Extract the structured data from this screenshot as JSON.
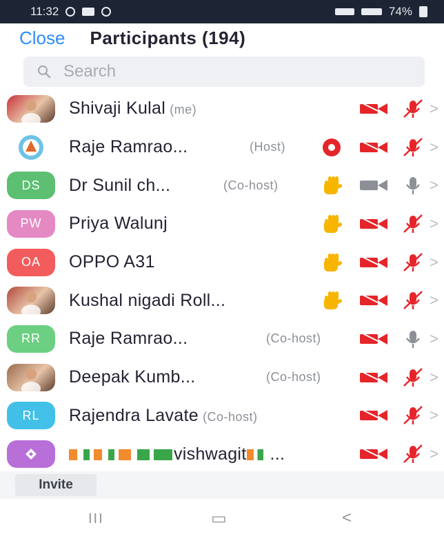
{
  "status_bar": {
    "time": "11:32",
    "battery": "74%"
  },
  "header": {
    "close_label": "Close",
    "title": "Participants (194)"
  },
  "search": {
    "placeholder": "Search"
  },
  "colors": {
    "accent": "#2d8cff",
    "muted_red": "#e5252a",
    "raise_hand": "#f7b500",
    "chevron": "#b9bcc1"
  },
  "participants": [
    {
      "name": "Shivaji Kulal",
      "role": "(me)",
      "avatar": {
        "type": "photo",
        "color": "#c7333a"
      },
      "hand_raised": false,
      "recording": false,
      "video_muted": true,
      "mic_muted": true
    },
    {
      "name": "Raje Ramrao...",
      "role": "(Host)",
      "avatar": {
        "type": "logo",
        "color": "#6ec3e6"
      },
      "hand_raised": false,
      "recording": true,
      "video_muted": true,
      "mic_muted": true
    },
    {
      "name": "Dr Sunil ch...",
      "role": "(Co-host)",
      "avatar": {
        "type": "initials",
        "initials": "DS",
        "color": "#5cbf72"
      },
      "hand_raised": true,
      "recording": false,
      "video_muted": false,
      "mic_muted": false
    },
    {
      "name": "Priya Walunj",
      "role": "",
      "avatar": {
        "type": "initials",
        "initials": "PW",
        "color": "#e589c3"
      },
      "hand_raised": true,
      "recording": false,
      "video_muted": true,
      "mic_muted": true
    },
    {
      "name": "OPPO A31",
      "role": "",
      "avatar": {
        "type": "initials",
        "initials": "OA",
        "color": "#f35c5c"
      },
      "hand_raised": true,
      "recording": false,
      "video_muted": true,
      "mic_muted": true
    },
    {
      "name": "Kushal nigadi Roll...",
      "role": "",
      "avatar": {
        "type": "photo",
        "color": "#b04a3a"
      },
      "hand_raised": true,
      "recording": false,
      "video_muted": true,
      "mic_muted": true
    },
    {
      "name": "Raje Ramrao...",
      "role": "(Co-host)",
      "avatar": {
        "type": "initials",
        "initials": "RR",
        "color": "#6ccf82"
      },
      "hand_raised": false,
      "recording": false,
      "video_muted": true,
      "mic_muted": false
    },
    {
      "name": "Deepak Kumb...",
      "role": "(Co-host)",
      "avatar": {
        "type": "photo",
        "color": "#9a6a4e"
      },
      "hand_raised": false,
      "recording": false,
      "video_muted": true,
      "mic_muted": true
    },
    {
      "name": "Rajendra Lavate",
      "role": "(Co-host)",
      "avatar": {
        "type": "initials",
        "initials": "RL",
        "color": "#42c0e8"
      },
      "hand_raised": false,
      "recording": false,
      "video_muted": true,
      "mic_muted": true
    },
    {
      "name": "vishwagit",
      "role": "",
      "avatar": {
        "type": "diamond",
        "color": "#b86fd8"
      },
      "hand_raised": false,
      "recording": false,
      "video_muted": true,
      "mic_muted": true
    }
  ],
  "footer": {
    "invite_label": "Invite"
  },
  "navbar": {
    "recents": "III",
    "home": "▭",
    "back": "<"
  }
}
